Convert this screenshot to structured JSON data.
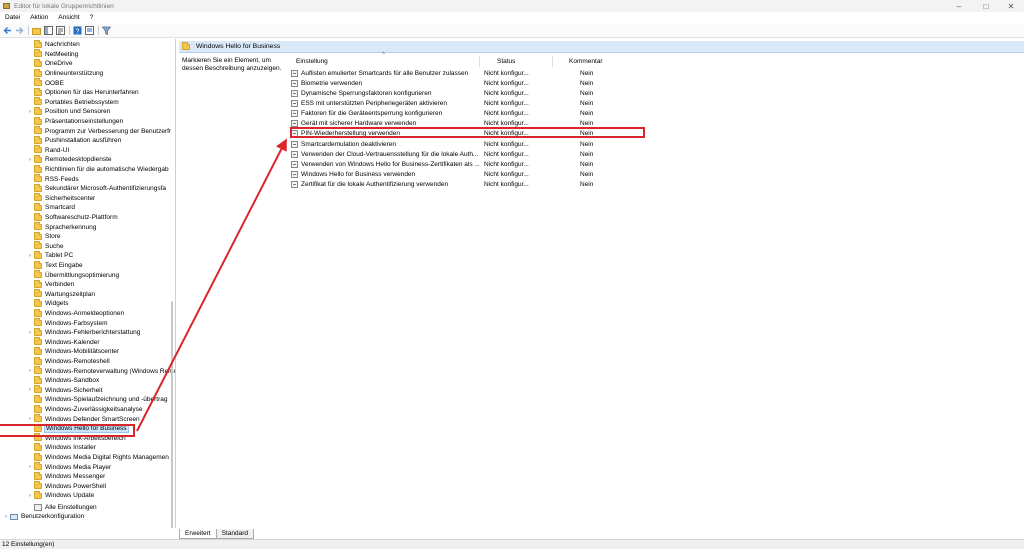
{
  "window": {
    "title": "Editor für lokale Gruppenrichtlinien",
    "controls": [
      "–",
      "□",
      "✕"
    ]
  },
  "menu": [
    "Datei",
    "Aktion",
    "Ansicht",
    "?"
  ],
  "toolbar": {
    "icons": [
      "back-arrow-icon",
      "forward-arrow-icon",
      "up-folder-icon",
      "show-hide-tree-icon",
      "export-list-icon",
      "help-icon",
      "properties-icon",
      "filter-icon"
    ]
  },
  "tree": {
    "items": [
      {
        "label": "Nachrichten",
        "expandable": false
      },
      {
        "label": "NetMeeting",
        "expandable": false
      },
      {
        "label": "OneDrive",
        "expandable": false
      },
      {
        "label": "Onlineunterstützung",
        "expandable": false
      },
      {
        "label": "OOBE",
        "expandable": false
      },
      {
        "label": "Optionen für das Herunterfahren",
        "expandable": false
      },
      {
        "label": "Portables Betriebssystem",
        "expandable": false
      },
      {
        "label": "Position und Sensoren",
        "expandable": true
      },
      {
        "label": "Präsentationseinstellungen",
        "expandable": false
      },
      {
        "label": "Programm zur Verbesserung der Benutzerfr",
        "expandable": false
      },
      {
        "label": "Pushinstallation ausführen",
        "expandable": false
      },
      {
        "label": "Rand-UI",
        "expandable": false
      },
      {
        "label": "Remotedesktopdienste",
        "expandable": true
      },
      {
        "label": "Richtlinien für die automatische Wiedergab",
        "expandable": false
      },
      {
        "label": "RSS-Feeds",
        "expandable": false
      },
      {
        "label": "Sekundärer Microsoft-Authentifizierungsfa",
        "expandable": false
      },
      {
        "label": "Sicherheitscenter",
        "expandable": false
      },
      {
        "label": "Smartcard",
        "expandable": false
      },
      {
        "label": "Softwareschutz-Plattform",
        "expandable": false
      },
      {
        "label": "Spracherkennung",
        "expandable": false
      },
      {
        "label": "Store",
        "expandable": false
      },
      {
        "label": "Suche",
        "expandable": false
      },
      {
        "label": "Tablet PC",
        "expandable": true
      },
      {
        "label": "Text Eingabe",
        "expandable": false
      },
      {
        "label": "Übermittlungsoptimierung",
        "expandable": false
      },
      {
        "label": "Verbinden",
        "expandable": false
      },
      {
        "label": "Wartungszeitplan",
        "expandable": false
      },
      {
        "label": "Widgets",
        "expandable": false
      },
      {
        "label": "Windows-Anmeldeoptionen",
        "expandable": false
      },
      {
        "label": "Windows-Farbsystem",
        "expandable": false
      },
      {
        "label": "Windows-Fehlerberichterstattung",
        "expandable": true
      },
      {
        "label": "Windows-Kalender",
        "expandable": false
      },
      {
        "label": "Windows-Mobilitätscenter",
        "expandable": false
      },
      {
        "label": "Windows-Remoteshell",
        "expandable": false
      },
      {
        "label": "Windows-Remoteverwaltung (Windows Remo",
        "expandable": true
      },
      {
        "label": "Windows-Sandbox",
        "expandable": false
      },
      {
        "label": "Windows-Sicherheit",
        "expandable": true
      },
      {
        "label": "Windows-Spielaufzeichnung und -übertrag",
        "expandable": false
      },
      {
        "label": "Windows-Zuverlässigkeitsanalyse",
        "expandable": false
      },
      {
        "label": "Windows Defender SmartScreen",
        "expandable": true
      },
      {
        "label": "Windows Hello for Business",
        "expandable": false,
        "selected": true
      },
      {
        "label": "Windows Ink-Arbeitsbereich",
        "expandable": false
      },
      {
        "label": "Windows Installer",
        "expandable": false
      },
      {
        "label": "Windows Media Digital Rights Managemen",
        "expandable": false
      },
      {
        "label": "Windows Media Player",
        "expandable": true
      },
      {
        "label": "Windows Messenger",
        "expandable": false
      },
      {
        "label": "Windows PowerShell",
        "expandable": false
      },
      {
        "label": "Windows Update",
        "expandable": true
      }
    ],
    "all_settings": "Alle Einstellungen",
    "user_config": "Benutzerkonfiguration"
  },
  "details": {
    "header": "Windows Hello for Business",
    "description": "Markieren Sie ein Element, um dessen Beschreibung anzuzeigen.",
    "columns": {
      "name": "Einstellung",
      "status": "Status",
      "comment": "Kommentar"
    },
    "rows": [
      {
        "name": "Auflisten emulierter Smartcards für alle Benutzer zulassen",
        "status": "Nicht konfigur...",
        "comment": "Nein"
      },
      {
        "name": "Biometrie verwenden",
        "status": "Nicht konfigur...",
        "comment": "Nein"
      },
      {
        "name": "Dynamische Sperrungsfaktoren konfigurieren",
        "status": "Nicht konfigur...",
        "comment": "Nein"
      },
      {
        "name": "ESS mit unterstützten Peripheriegeräten aktivieren",
        "status": "Nicht konfigur...",
        "comment": "Nein"
      },
      {
        "name": "Faktoren für die Geräteentsperrung konfigurieren",
        "status": "Nicht konfigur...",
        "comment": "Nein"
      },
      {
        "name": "Gerät mit sicherer Hardware verwenden",
        "status": "Nicht konfigur...",
        "comment": "Nein"
      },
      {
        "name": "PIN-Wiederherstellung verwenden",
        "status": "Nicht konfigur...",
        "comment": "Nein",
        "highlighted": true
      },
      {
        "name": "Smartcardemulation deaktivieren",
        "status": "Nicht konfigur...",
        "comment": "Nein"
      },
      {
        "name": "Verwenden der Cloud-Vertrauensstellung für die lokale Auth...",
        "status": "Nicht konfigur...",
        "comment": "Nein"
      },
      {
        "name": "Verwenden von Windows Hello for Business-Zertifikaten als ...",
        "status": "Nicht konfigur...",
        "comment": "Nein"
      },
      {
        "name": "Windows Hello for Business verwenden",
        "status": "Nicht konfigur...",
        "comment": "Nein"
      },
      {
        "name": "Zertifikat für die lokale Authentifizierung verwenden",
        "status": "Nicht konfigur...",
        "comment": "Nein"
      }
    ],
    "tabs": [
      "Erweitert",
      "Standard"
    ]
  },
  "status_bar": "12 Einstellung(en)",
  "colors": {
    "highlight": "#d9262d",
    "selection": "#cce4f7",
    "header_band": "#d9e8f7"
  }
}
